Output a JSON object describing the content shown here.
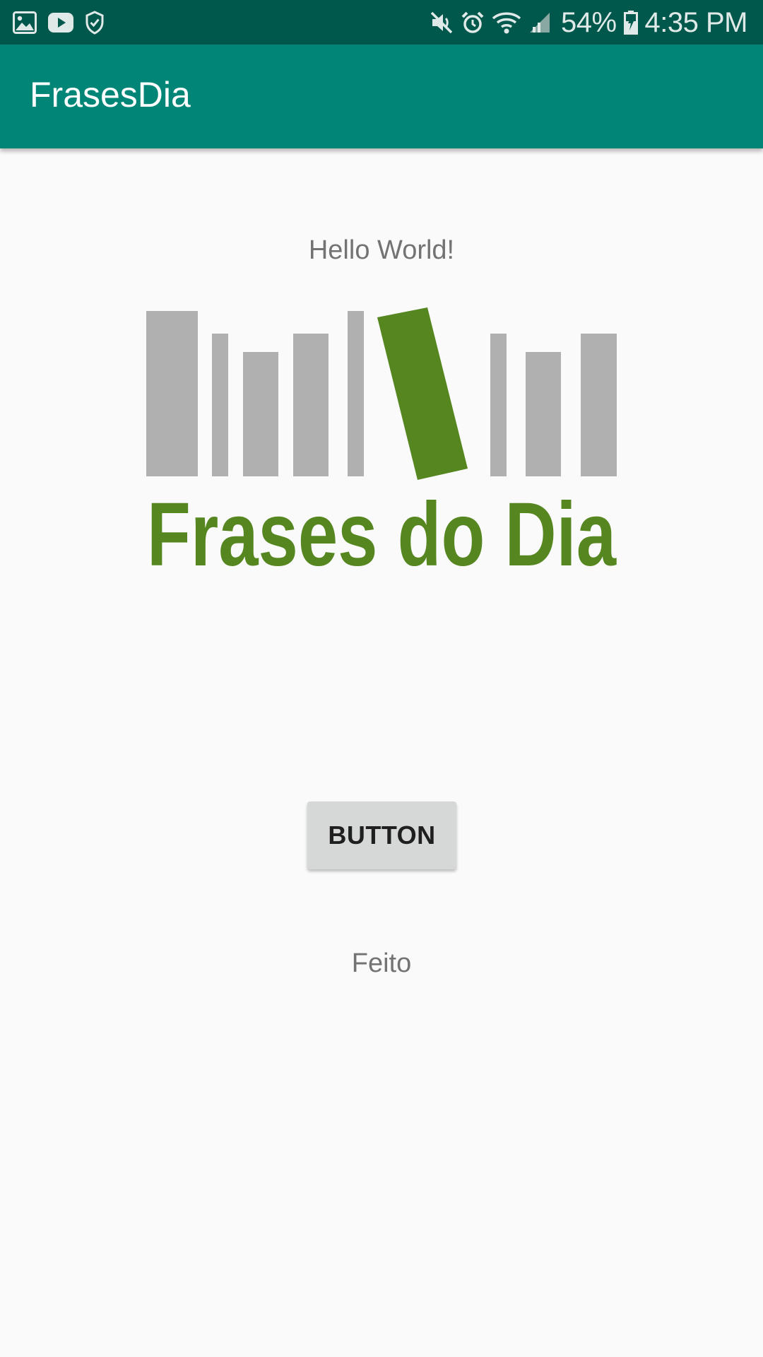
{
  "status_bar": {
    "left_icons": [
      "gallery-icon",
      "youtube-icon",
      "shield-check-icon"
    ],
    "right_icons": [
      "mute-icon",
      "alarm-icon",
      "wifi-icon",
      "signal-icon",
      "battery-icon"
    ],
    "battery": "54%",
    "time": "4:35 PM",
    "background_color": "#00574b"
  },
  "app_bar": {
    "title": "FrasesDia",
    "color": "#008577"
  },
  "main": {
    "hello_text": "Hello World!",
    "logo_text": "Frases do Dia",
    "button_label": "BUTTON",
    "status_text": "Feito"
  },
  "colors": {
    "logo_green": "#55861f",
    "logo_gray": "#b0b0b0",
    "background": "#fafafa"
  }
}
